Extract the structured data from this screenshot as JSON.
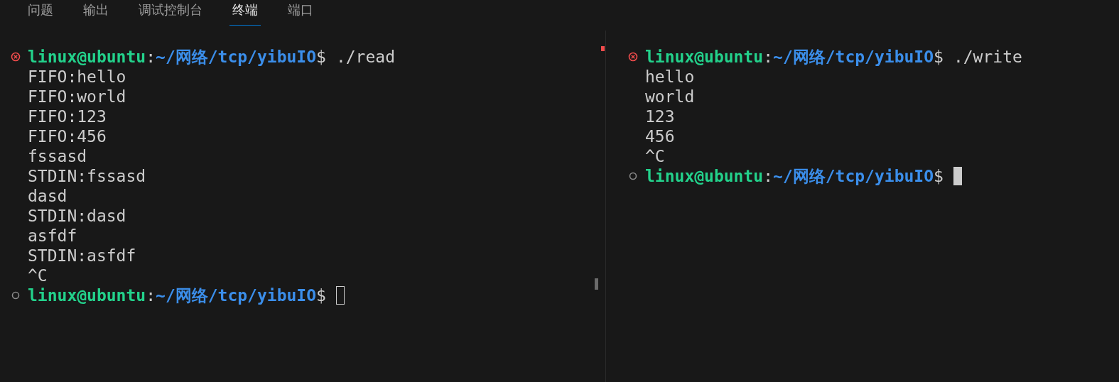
{
  "tabs": [
    {
      "label": "问题",
      "selected": false
    },
    {
      "label": "输出",
      "selected": false
    },
    {
      "label": "调试控制台",
      "selected": false
    },
    {
      "label": "终端",
      "selected": true
    },
    {
      "label": "端口",
      "selected": false
    }
  ],
  "panes": [
    {
      "focused": false,
      "lines": [
        {
          "kind": "prompt",
          "failed": true,
          "user": "linux@ubuntu",
          "colon": ":",
          "path": "~/网络/tcp/yibuIO",
          "dollar": "$",
          "command": "./read"
        },
        {
          "kind": "output",
          "text": "FIFO:hello"
        },
        {
          "kind": "output",
          "text": "FIFO:world"
        },
        {
          "kind": "output",
          "text": "FIFO:123"
        },
        {
          "kind": "output",
          "text": "FIFO:456"
        },
        {
          "kind": "output",
          "text": "fssasd"
        },
        {
          "kind": "output",
          "text": "STDIN:fssasd"
        },
        {
          "kind": "output",
          "text": "dasd"
        },
        {
          "kind": "output",
          "text": "STDIN:dasd"
        },
        {
          "kind": "output",
          "text": "asfdf"
        },
        {
          "kind": "output",
          "text": "STDIN:asfdf"
        },
        {
          "kind": "output",
          "text": "^C"
        },
        {
          "kind": "prompt",
          "failed": false,
          "user": "linux@ubuntu",
          "colon": ":",
          "path": "~/网络/tcp/yibuIO",
          "dollar": "$",
          "cursor": true
        }
      ]
    },
    {
      "focused": true,
      "lines": [
        {
          "kind": "prompt",
          "failed": true,
          "user": "linux@ubuntu",
          "colon": ":",
          "path": "~/网络/tcp/yibuIO",
          "dollar": "$",
          "command": "./write"
        },
        {
          "kind": "output",
          "text": "hello"
        },
        {
          "kind": "output",
          "text": "world"
        },
        {
          "kind": "output",
          "text": "123"
        },
        {
          "kind": "output",
          "text": "456"
        },
        {
          "kind": "output",
          "text": "^C"
        },
        {
          "kind": "prompt",
          "failed": false,
          "user": "linux@ubuntu",
          "colon": ":",
          "path": "~/网络/tcp/yibuIO",
          "dollar": "$",
          "cursor": true
        }
      ]
    }
  ]
}
